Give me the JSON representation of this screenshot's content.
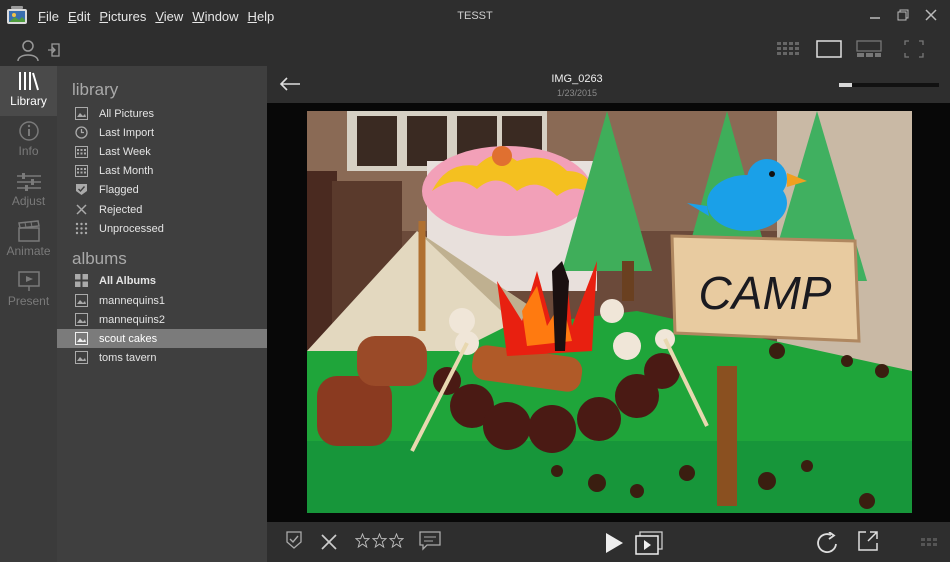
{
  "window": {
    "title": "TESST",
    "menu": [
      "File",
      "Edit",
      "Pictures",
      "View",
      "Window",
      "Help"
    ]
  },
  "rail": {
    "items": [
      {
        "label": "Library",
        "icon": "library-icon",
        "active": true
      },
      {
        "label": "Info",
        "icon": "info-icon",
        "active": false
      },
      {
        "label": "Adjust",
        "icon": "adjust-icon",
        "active": false
      },
      {
        "label": "Animate",
        "icon": "animate-icon",
        "active": false
      },
      {
        "label": "Present",
        "icon": "present-icon",
        "active": false
      }
    ]
  },
  "sidebar": {
    "library_title": "library",
    "library_items": [
      {
        "label": "All Pictures",
        "icon": "pictures-icon"
      },
      {
        "label": "Last Import",
        "icon": "clock-icon"
      },
      {
        "label": "Last Week",
        "icon": "calendar-icon"
      },
      {
        "label": "Last Month",
        "icon": "calendar-icon"
      },
      {
        "label": "Flagged",
        "icon": "flag-icon"
      },
      {
        "label": "Rejected",
        "icon": "reject-icon"
      },
      {
        "label": "Unprocessed",
        "icon": "dots-icon"
      }
    ],
    "albums_title": "albums",
    "album_items": [
      {
        "label": "All Albums",
        "bold": true
      },
      {
        "label": "mannequins1"
      },
      {
        "label": "mannequins2"
      },
      {
        "label": "scout cakes",
        "selected": true
      },
      {
        "label": "toms tavern"
      }
    ]
  },
  "viewer": {
    "image_name": "IMG_0263",
    "image_date": "1/23/2015",
    "zoom_fraction": 0.13,
    "sign_text": "CAMP"
  },
  "colors": {
    "accent": "#7b7b7b",
    "rail_active": "#4a4a4a",
    "background": "#2b2b2b"
  }
}
